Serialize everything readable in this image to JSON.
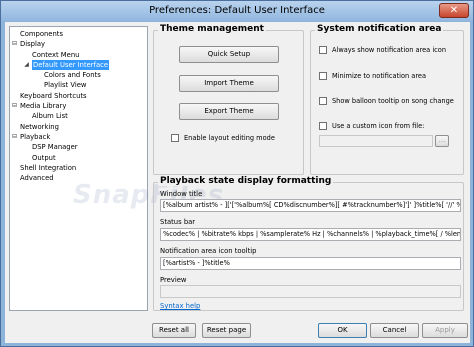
{
  "window": {
    "title": "Preferences: Default User Interface",
    "close_glyph": "✕"
  },
  "tree": {
    "items": [
      {
        "label": "Components",
        "level": 0,
        "expander": ""
      },
      {
        "label": "Display",
        "level": 0,
        "expander": "⊟"
      },
      {
        "label": "Context Menu",
        "level": 1,
        "expander": ""
      },
      {
        "label": "Default User Interface",
        "level": 1,
        "expander": "◢",
        "selected": true
      },
      {
        "label": "Colors and Fonts",
        "level": 2,
        "expander": ""
      },
      {
        "label": "Playlist View",
        "level": 2,
        "expander": ""
      },
      {
        "label": "Keyboard Shortcuts",
        "level": 0,
        "expander": ""
      },
      {
        "label": "Media Library",
        "level": 0,
        "expander": "⊟"
      },
      {
        "label": "Album List",
        "level": 1,
        "expander": ""
      },
      {
        "label": "Networking",
        "level": 0,
        "expander": ""
      },
      {
        "label": "Playback",
        "level": 0,
        "expander": "⊟"
      },
      {
        "label": "DSP Manager",
        "level": 1,
        "expander": ""
      },
      {
        "label": "Output",
        "level": 1,
        "expander": ""
      },
      {
        "label": "Shell Integration",
        "level": 0,
        "expander": ""
      },
      {
        "label": "Advanced",
        "level": 0,
        "expander": ""
      }
    ]
  },
  "theme": {
    "title": "Theme management",
    "quick_setup": "Quick Setup",
    "import": "Import Theme",
    "export": "Export Theme",
    "layout_editing": "Enable layout editing mode"
  },
  "notify": {
    "title": "System notification area",
    "always_show": "Always show notification area icon",
    "minimize": "Minimize to notification area",
    "balloon": "Show balloon tooltip on song change",
    "custom_icon": "Use a custom icon from file:",
    "browse": "..."
  },
  "playback": {
    "title": "Playback state display formatting",
    "window_title_label": "Window title",
    "window_title_value": "[%album artist% - ]['['%album%[ CD%discnumber%][ #%tracknumber%]']' ]%title%[ '//' %track a",
    "status_bar_label": "Status bar",
    "status_bar_value": "%codec% | %bitrate% kbps | %samplerate% Hz | %channels% | %playback_time%[ / %length%",
    "tooltip_label": "Notification area icon tooltip",
    "tooltip_value": "[%artist% - ]%title%",
    "preview_label": "Preview",
    "preview_value": "",
    "syntax_help": "Syntax help"
  },
  "footer": {
    "reset_all": "Reset all",
    "reset_page": "Reset page",
    "ok": "OK",
    "cancel": "Cancel",
    "apply": "Apply"
  },
  "watermark": "SnapFiles"
}
